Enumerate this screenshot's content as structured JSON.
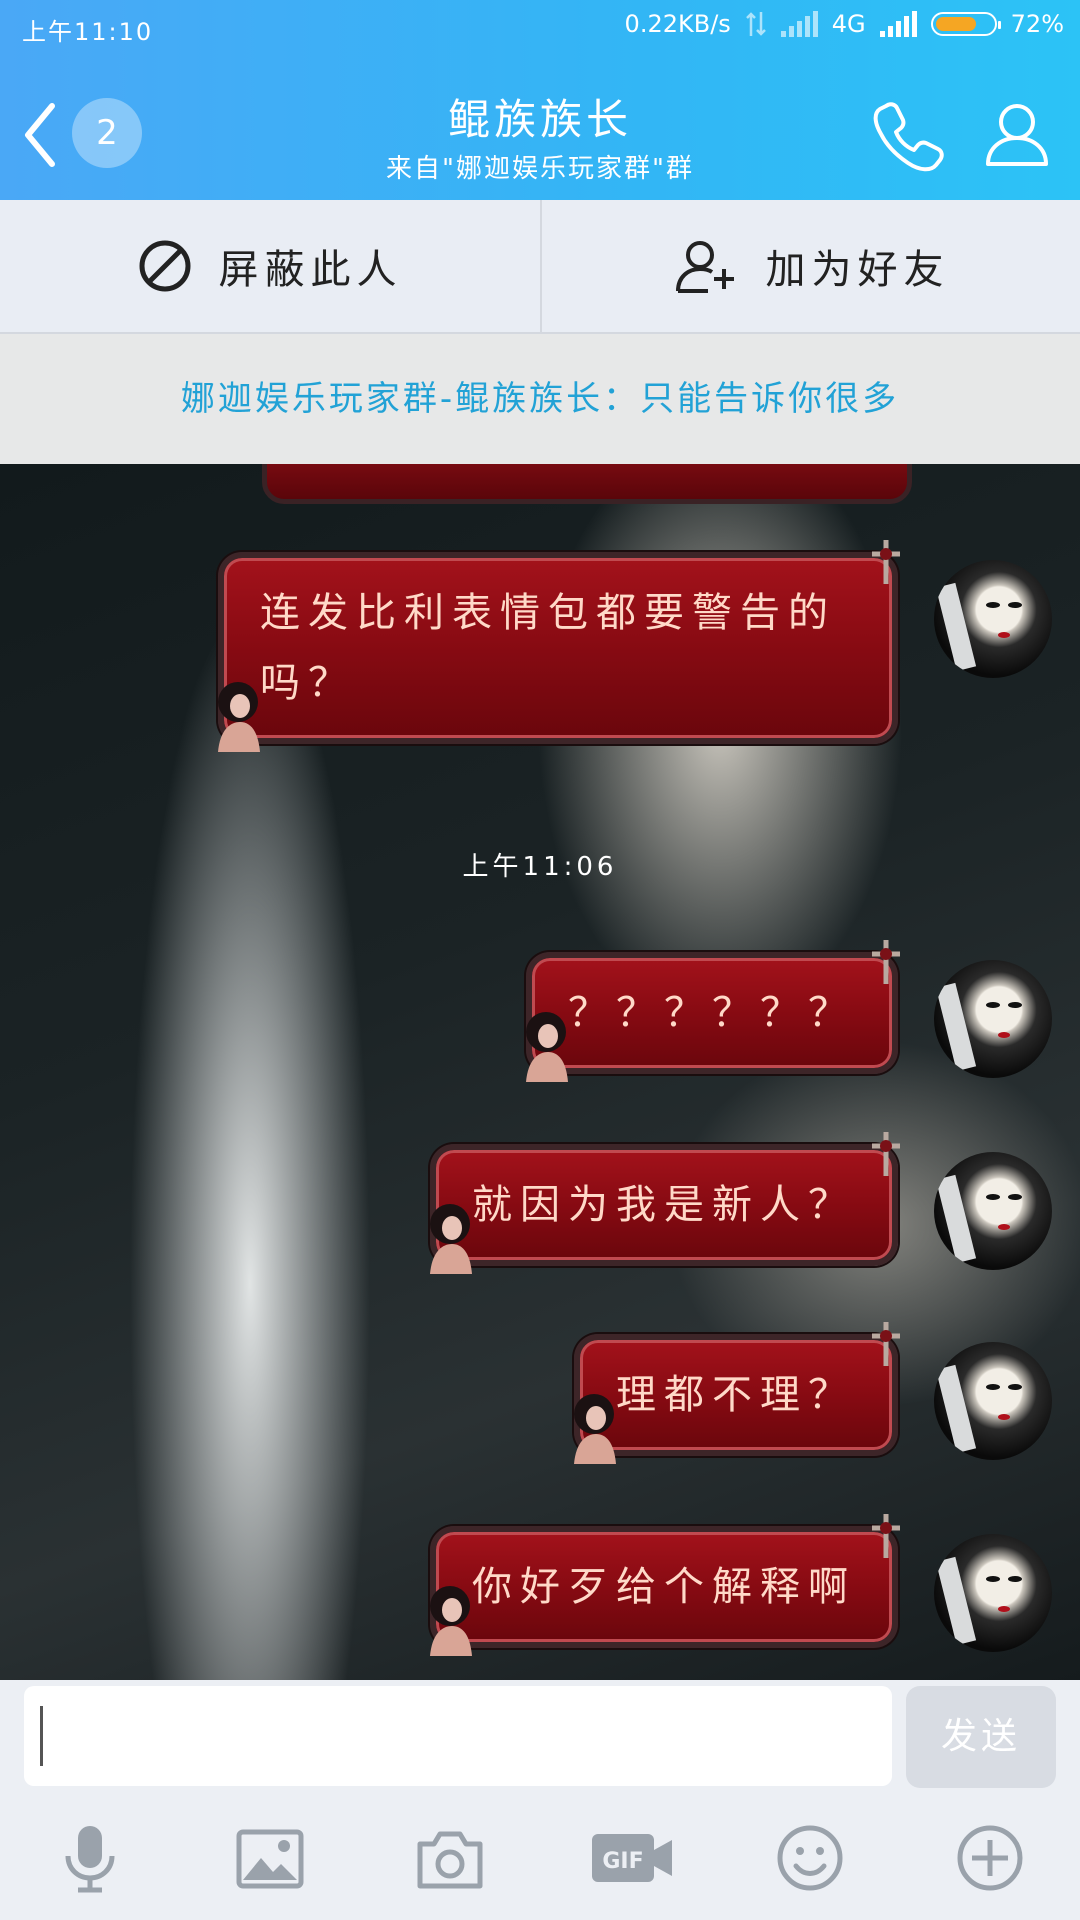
{
  "status_bar": {
    "time": "上午11:10",
    "network_speed": "0.22KB/s",
    "network_type": "4G",
    "battery_level": 0.72,
    "battery_text": "72%"
  },
  "header": {
    "unread_count": "2",
    "title": "鲲族族长",
    "subtitle": "来自\"娜迦娱乐玩家群\"群"
  },
  "actions": {
    "block_label": "屏蔽此人",
    "add_friend_label": "加为好友"
  },
  "notice": {
    "text": "娜迦娱乐玩家群-鲲族族长：只能告诉你很多"
  },
  "chat": {
    "messages": [
      {
        "text": "连发比利表情包都要警告的吗？"
      },
      {
        "text": "？？？？？？"
      },
      {
        "text": "就因为我是新人？"
      },
      {
        "text": "理都不理？"
      },
      {
        "text": "你好歹给个解释啊"
      }
    ],
    "time_separator": "上午11:06"
  },
  "input": {
    "value": "",
    "placeholder": "",
    "send_label": "发送"
  },
  "toolbar": [
    "microphone-icon",
    "image-icon",
    "camera-icon",
    "gif-icon",
    "emoji-icon",
    "plus-icon"
  ],
  "colors": {
    "header": "#3ab0f6",
    "notice_text": "#22a2d6",
    "bubble": "#8a0b13"
  }
}
